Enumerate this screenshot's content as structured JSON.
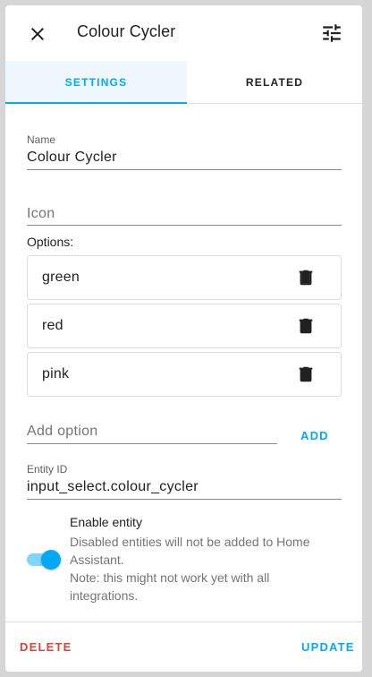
{
  "dialog": {
    "title": "Colour Cycler"
  },
  "tabs": [
    {
      "label": "SETTINGS",
      "active": true
    },
    {
      "label": "RELATED",
      "active": false
    }
  ],
  "fields": {
    "name": {
      "label": "Name",
      "value": "Colour Cycler"
    },
    "icon": {
      "placeholder": "Icon"
    },
    "add_option": {
      "placeholder": "Add option"
    },
    "entity_id": {
      "label": "Entity ID",
      "value": "input_select.colour_cycler"
    }
  },
  "options": {
    "label": "Options:",
    "items": [
      "green",
      "red",
      "pink"
    ],
    "add_label": "ADD"
  },
  "enable_entity": {
    "title": "Enable entity",
    "description": "Disabled entities will not be added to Home Assistant.",
    "note": "Note: this might not work yet with all integrations.",
    "enabled": true
  },
  "footer": {
    "delete_label": "DELETE",
    "update_label": "UPDATE"
  },
  "colors": {
    "accent": "#03a9f4",
    "danger": "#db4437",
    "tab_active_bg": "#eef7fd"
  }
}
